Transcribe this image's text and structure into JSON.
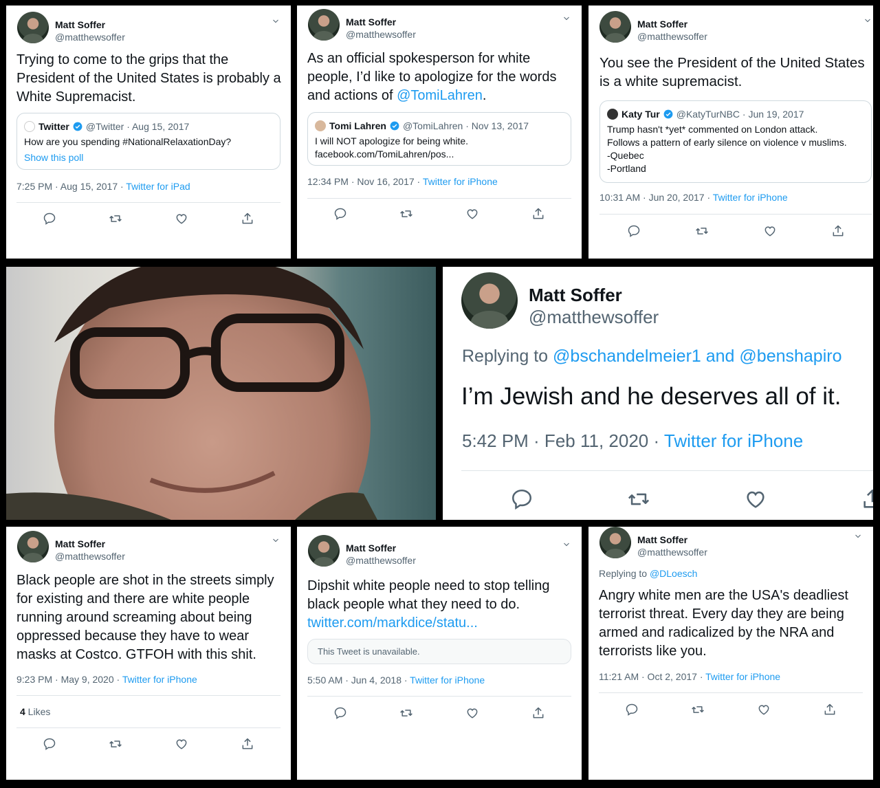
{
  "tweets": [
    {
      "name": "Matt Soffer",
      "handle": "@matthewsoffer",
      "body": "Trying to come to the grips that the President of the United States is probably a White Supremacist.",
      "quote": {
        "name": "Twitter",
        "sub": "@Twitter · Aug 15, 2017",
        "text": "How are you spending #NationalRelaxationDay?",
        "link": "Show this poll"
      },
      "time": "7:25 PM · Aug 15, 2017 · ",
      "source": "Twitter for iPad"
    },
    {
      "name": "Matt Soffer",
      "handle": "@matthewsoffer",
      "body_pre": "As an official spokesperson for white people, I’d like to apologize for the words and actions of ",
      "body_link": "@TomiLahren",
      "body_post": ".",
      "quote": {
        "name": "Tomi Lahren",
        "sub": "@TomiLahren · Nov 13, 2017",
        "text": "I will NOT apologize for being white.\nfacebook.com/TomiLahren/pos..."
      },
      "time": "12:34 PM · Nov 16, 2017 · ",
      "source": "Twitter for iPhone"
    },
    {
      "name": "Matt Soffer",
      "handle": "@matthewsoffer",
      "body": "You see the President of the United States is a white supremacist.",
      "quote": {
        "name": "Katy Tur",
        "sub": "@KatyTurNBC · Jun 19, 2017",
        "text": "Trump hasn't *yet* commented on London attack.\nFollows a pattern of early silence on violence v muslims.\n-Quebec\n-Portland"
      },
      "time": "10:31 AM · Jun 20, 2017 · ",
      "source": "Twitter for iPhone"
    },
    {
      "name": "Matt Soffer",
      "handle": "@matthewsoffer",
      "reply_prefix": "Replying to ",
      "reply_to": "@bschandelmeier1 and @benshapiro",
      "body": "I’m Jewish and he deserves all of it.",
      "time": "5:42 PM · Feb 11, 2020 · ",
      "source": "Twitter for iPhone"
    },
    {
      "name": "Matt Soffer",
      "handle": "@matthewsoffer",
      "body": "Black people are shot in the streets simply for existing and there are white people running around screaming about being oppressed because they have to wear masks at Costco. GTFOH with this shit.",
      "time": "9:23 PM · May 9, 2020 · ",
      "source": "Twitter for iPhone",
      "likes_count": "4",
      "likes_label": " Likes"
    },
    {
      "name": "Matt Soffer",
      "handle": "@matthewsoffer",
      "body": "Dipshit white people need to stop telling black people what they need to do.",
      "body_link": "twitter.com/markdice/statu...",
      "unavailable": "This Tweet is unavailable.",
      "time": "5:50 AM · Jun 4, 2018 · ",
      "source": "Twitter for iPhone"
    },
    {
      "name": "Matt Soffer",
      "handle": "@matthewsoffer",
      "reply_prefix": "Replying to ",
      "reply_to": "@DLoesch",
      "body": "Angry white men are the USA's deadliest terrorist threat. Every day they are being armed and radicalized by the NRA and terrorists like you.",
      "time": "11:21 AM · Oct 2, 2017 · ",
      "source": "Twitter for iPhone"
    }
  ],
  "icons": [
    "reply-icon",
    "retweet-icon",
    "like-icon",
    "share-icon",
    "chevron-down-icon",
    "verified-badge-icon"
  ],
  "colors": {
    "accent": "#1d9bf0",
    "text": "#0f1419",
    "muted": "#536471",
    "background": "#000000"
  }
}
